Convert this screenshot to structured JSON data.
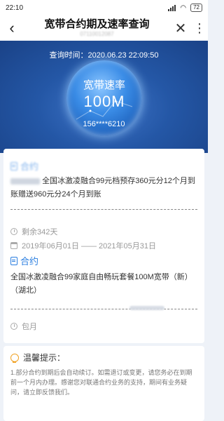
{
  "status": {
    "time": "22:10",
    "battery": "72"
  },
  "header": {
    "title": "宽带合约期及速率查询",
    "account_number": "07110012087"
  },
  "hero": {
    "query_time": "查询时间：2020.06.23 22:09:50",
    "rate_label": "宽带速率",
    "rate_value": "100M",
    "phone": "156****6210"
  },
  "contract1": {
    "title": "合约",
    "description": "全国冰激凌融合99元档预存360元分12个月到账赠送960元分24个月到账",
    "remaining": "剩余342天",
    "date_range": "2019年06月01日 —— 2021年05月31日"
  },
  "contract2": {
    "title": "合约",
    "description": "全国冰激凌融合99家庭自由畅玩套餐100M宽带（新）（湖北）",
    "billing": "包月"
  },
  "tips": {
    "title": "温馨提示：",
    "text": "1.部分合约到期后会自动续订。如需退订或变更，请您务必在到期前一个月内办理。感谢您对联通合约业务的支持，期间有业务疑问，请立即反馈我们。"
  }
}
